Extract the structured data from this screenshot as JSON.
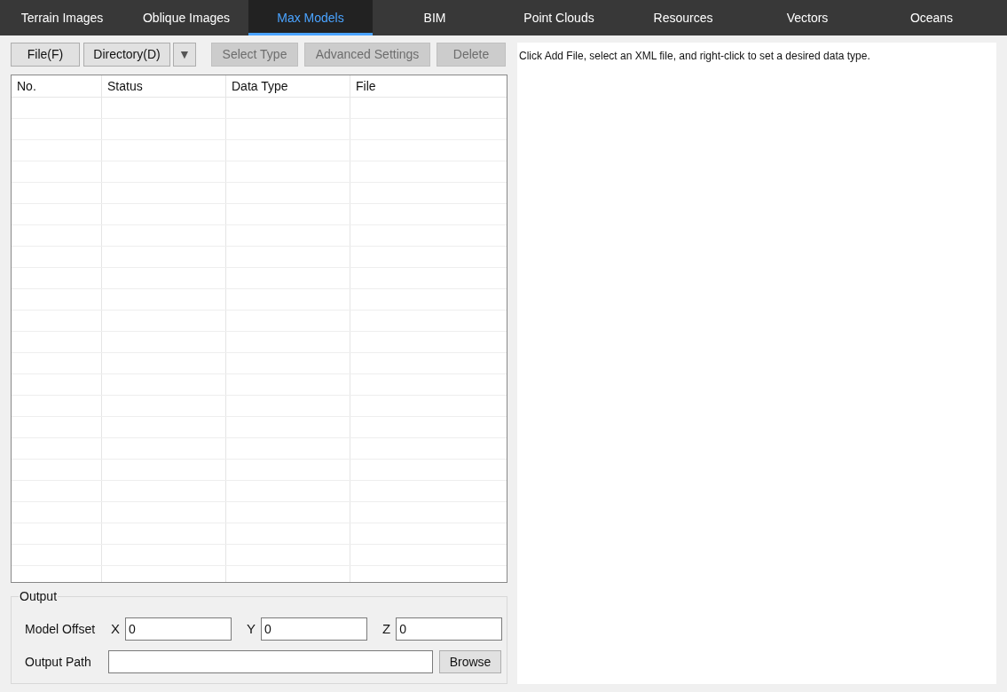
{
  "tabs": [
    {
      "label": "Terrain Images",
      "selected": false
    },
    {
      "label": "Oblique Images",
      "selected": false
    },
    {
      "label": "Max Models",
      "selected": true
    },
    {
      "label": "BIM",
      "selected": false
    },
    {
      "label": "Point Clouds",
      "selected": false
    },
    {
      "label": "Resources",
      "selected": false
    },
    {
      "label": "Vectors",
      "selected": false
    },
    {
      "label": "Oceans",
      "selected": false
    }
  ],
  "toolbar": [
    {
      "kind": "button",
      "label": "File(F)",
      "disabled": false
    },
    {
      "kind": "button",
      "label": "Directory(D)",
      "disabled": false
    },
    {
      "kind": "dropdown",
      "label": "▼",
      "disabled": false
    },
    {
      "kind": "button",
      "label": "Select Type",
      "disabled": true
    },
    {
      "kind": "button",
      "label": "Advanced Settings",
      "disabled": true
    },
    {
      "kind": "button",
      "label": "Delete",
      "disabled": true
    }
  ],
  "table": {
    "columns": [
      "No.",
      "Status",
      "Data Type",
      "File"
    ]
  },
  "output": {
    "title": "Output",
    "offset_label": "Model Offset",
    "offsets": [
      {
        "axis": "X",
        "value": "0"
      },
      {
        "axis": "Y",
        "value": "0"
      },
      {
        "axis": "Z",
        "value": "0"
      }
    ],
    "path_label": "Output Path",
    "browse": "Browse"
  },
  "hint": "Click Add File, select an XML file, and right-click to set a desired data type."
}
